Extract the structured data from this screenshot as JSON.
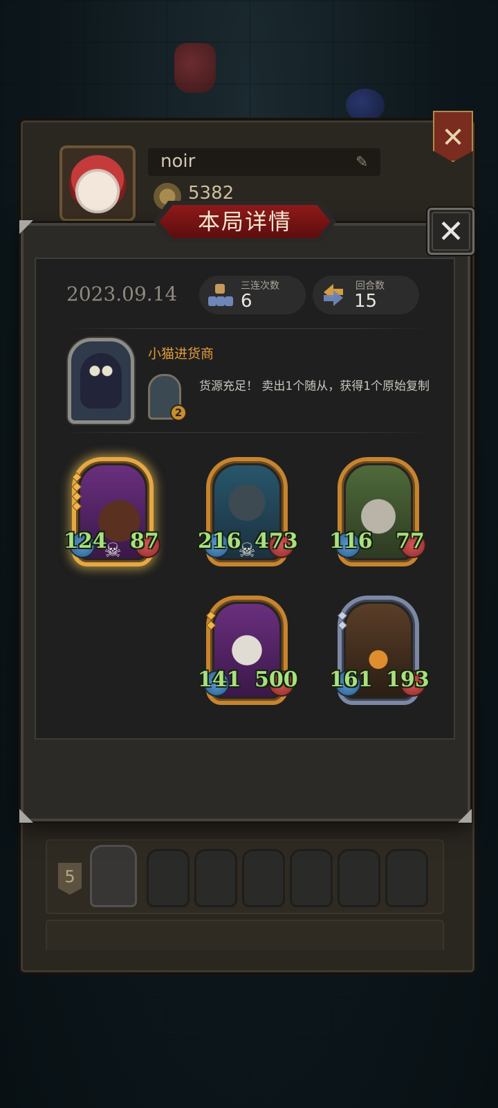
{
  "profile": {
    "player_name": "noir",
    "coins": "5382"
  },
  "dialog": {
    "title": "本局详情",
    "close_label": "✕",
    "date": "2023.09.14",
    "triples": {
      "label": "三连次数",
      "value": "6"
    },
    "rounds": {
      "label": "回合数",
      "value": "15"
    }
  },
  "hero": {
    "name": "小猫进货商",
    "skill_level": "2",
    "skill_description": "货源充足！ 卖出1个随从，获得1个原始复制"
  },
  "minions": [
    {
      "attack": "124",
      "health": "87",
      "skull": true,
      "frame": "gold",
      "tier_pips": 4,
      "glow": true
    },
    {
      "attack": "216",
      "health": "473",
      "skull": true,
      "frame": "gold",
      "tier_pips": 0,
      "glow": false
    },
    {
      "attack": "116",
      "health": "77",
      "skull": false,
      "frame": "gold",
      "tier_pips": 0,
      "glow": false
    },
    {
      "attack": "141",
      "health": "500",
      "skull": false,
      "frame": "gold",
      "tier_pips": 2,
      "glow": false
    },
    {
      "attack": "161",
      "health": "193",
      "skull": false,
      "frame": "silver",
      "tier_pips": 2,
      "glow": false
    }
  ],
  "history_row": {
    "rank": "5"
  },
  "icons": {
    "close": "close-icon",
    "edit": "pencil-icon",
    "coin": "coin-icon",
    "triples": "triple-icon",
    "rounds": "rounds-icon",
    "skull": "skull-icon"
  },
  "colors": {
    "title_red": "#8e1a1a",
    "hero_name": "#e39a3b",
    "stat_green": "#a8e07f",
    "gold_frame": "#c7842f",
    "silver_frame": "#7c88a4"
  }
}
